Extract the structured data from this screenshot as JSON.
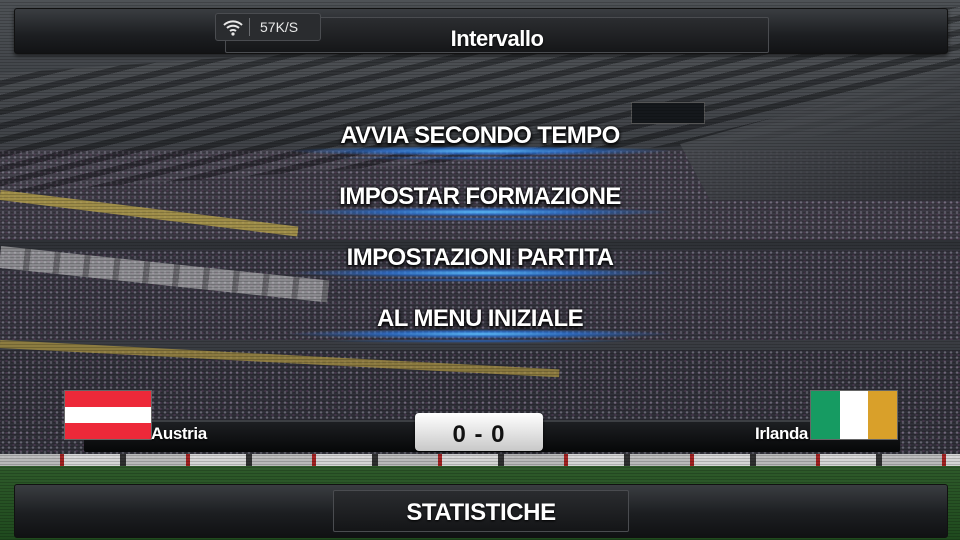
{
  "header": {
    "title": "Intervallo",
    "network_speed": "57K/S",
    "network_icon": "wifi-icon"
  },
  "menu": {
    "items": [
      {
        "label": "AVVIA SECONDO TEMPO"
      },
      {
        "label": "IMPOSTAR FORMAZIONE"
      },
      {
        "label": "IMPOSTAZIONI PARTITA"
      },
      {
        "label": "AL MENU INIZIALE"
      }
    ],
    "glow_color": "#3aa0ff"
  },
  "match": {
    "home": {
      "name": "Austria",
      "flag_colors": [
        "#ed2939",
        "#ffffff",
        "#ed2939"
      ]
    },
    "away": {
      "name": "Irlanda",
      "flag_colors": [
        "#169b62",
        "#ffffff",
        "#d9a02a"
      ]
    },
    "score": "0 - 0"
  },
  "footer": {
    "stats_label": "STATISTICHE"
  }
}
